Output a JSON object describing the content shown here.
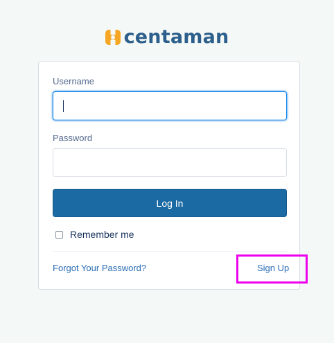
{
  "brand": {
    "name": "centaman",
    "logo_icon": "centaman-logo-icon",
    "text_color": "#2d5f8c",
    "icon_color": "#f5a623"
  },
  "form": {
    "username_label": "Username",
    "username_value": "",
    "password_label": "Password",
    "password_value": "",
    "login_label": "Log In",
    "remember_label": "Remember me",
    "remember_checked": false
  },
  "links": {
    "forgot_password": "Forgot Your Password?",
    "sign_up": "Sign Up"
  },
  "colors": {
    "background": "#f4f8f6",
    "primary_button": "#1b6aa3",
    "link": "#2a6db6",
    "focus_border": "#1589ee",
    "highlight": "#ee00ee"
  }
}
